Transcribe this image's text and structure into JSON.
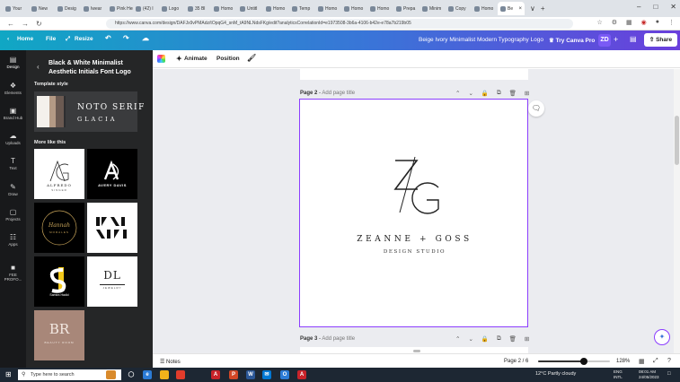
{
  "browser": {
    "tabs": [
      {
        "label": "Your"
      },
      {
        "label": "New"
      },
      {
        "label": "Desig"
      },
      {
        "label": "Iwear"
      },
      {
        "label": "Pink Hera"
      },
      {
        "label": "(42) I"
      },
      {
        "label": "Logo"
      },
      {
        "label": "35 Bl"
      },
      {
        "label": "Homo"
      },
      {
        "label": "Untitl"
      },
      {
        "label": "Homo"
      },
      {
        "label": "Temp"
      },
      {
        "label": "Homo"
      },
      {
        "label": "Homo"
      },
      {
        "label": "Homo"
      },
      {
        "label": "Prepa"
      },
      {
        "label": "Minim"
      },
      {
        "label": "Copy"
      },
      {
        "label": "Homo"
      },
      {
        "label": "Be"
      }
    ],
    "url": "https://www.canva.com/design/DAFJx9vPMAdz/tOpqG4_snM_tA9NLNdsFKg/edit?analyticsCorrelationId=e1973508-3b6a-4106-b42e-e78a7b219b05"
  },
  "canva": {
    "home": "Home",
    "file": "File",
    "resize": "Resize",
    "doc_title": "Beige Ivory Minimalist Modern Typography Logo",
    "try_pro": "Try Canva Pro",
    "avatar": "ZD",
    "share": "Share"
  },
  "rail": [
    {
      "label": "Design",
      "icon": "design-icon"
    },
    {
      "label": "Elements",
      "icon": "elements-icon"
    },
    {
      "label": "Brand Hub",
      "icon": "brand-hub-icon"
    },
    {
      "label": "Uploads",
      "icon": "uploads-icon"
    },
    {
      "label": "Text",
      "icon": "text-icon"
    },
    {
      "label": "Draw",
      "icon": "draw-icon"
    },
    {
      "label": "Projects",
      "icon": "projects-icon"
    },
    {
      "label": "Apps",
      "icon": "apps-icon"
    },
    {
      "label": "FEE PROFO...",
      "icon": "app-icon"
    }
  ],
  "panel": {
    "title": "Black & White Minimalist Aesthetic Initials Font Logo",
    "template_style_heading": "Template style",
    "style_font1": "NOTO SERIF",
    "style_font2": "GLACIA",
    "more_like_this": "More like this",
    "thumbnails": [
      {
        "name": "ALFREDO",
        "sub": "SINGER"
      },
      {
        "name": "AVERY DAVIS"
      },
      {
        "name": "Hannah",
        "sub": "MORALES"
      },
      {
        "name": "KN"
      },
      {
        "name": "Samira Hadid"
      },
      {
        "name": "DL",
        "sub": "JEWELRY"
      },
      {
        "name": "BR",
        "sub": "BEAUTY ROOM"
      }
    ],
    "swatch_colors": [
      "#f4f1ec",
      "#b49a85",
      "#6b5a52",
      "#2e2e30"
    ]
  },
  "toolbar": {
    "animate": "Animate",
    "position": "Position"
  },
  "pages": {
    "page2_label": "Page 2",
    "page2_placeholder": "Add page title",
    "page3_label": "Page 3",
    "page3_placeholder": "Add page title",
    "monogram_left": "Z",
    "monogram_right": "G",
    "brand_name": "ZEANNE + GOSS",
    "brand_sub": "DESIGN STUDIO"
  },
  "footer": {
    "notes": "Notes",
    "page_counter": "Page 2 / 6",
    "zoom_fraction": 0.64,
    "zoom": "128%"
  },
  "taskbar": {
    "search_placeholder": "Type here to search",
    "weather": "12°C  Partly cloudy",
    "lang_line1": "ENG",
    "lang_line2": "INTL",
    "time": "08:01 AM",
    "date": "24/05/2023"
  }
}
